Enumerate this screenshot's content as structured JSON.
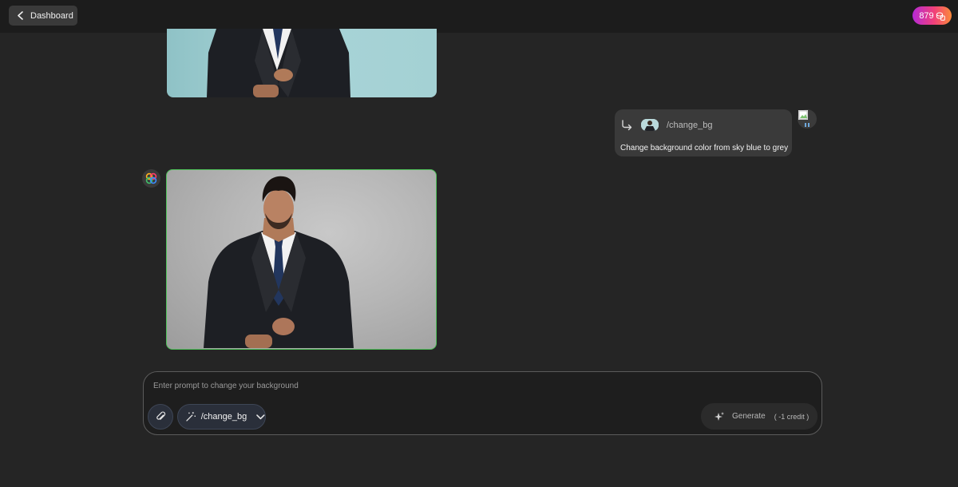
{
  "header": {
    "back_label": "Dashboard",
    "credits": "879"
  },
  "chat": {
    "user_message": {
      "command": "/change_bg",
      "text": "Change background color from sky blue to grey"
    }
  },
  "composer": {
    "placeholder": "Enter prompt to change your background",
    "tool_label": "/change_bg",
    "generate_label": "Generate",
    "generate_cost": "( -1 credit )"
  },
  "colors": {
    "accent_green": "#4fc25a",
    "badge_start": "#b52ad6",
    "badge_end": "#fb8a3a"
  }
}
